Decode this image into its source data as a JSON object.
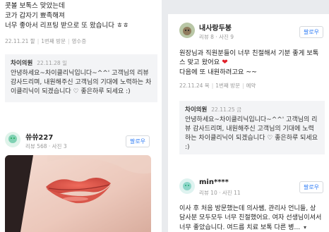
{
  "review_top": {
    "lines": [
      "콧볼 보톡스 맞았는데",
      "코가 갑자기 뾰족해져",
      "너무 좋아서 리프팅 받으로 또 왔습니다 ㅎㅎ"
    ],
    "date": "22.11.21 할",
    "replies": "1번째 방문",
    "receipt": "영수증",
    "reply": {
      "name": "차이의원",
      "date": "22.11.28 일",
      "text": "안녕하세요~차이클리닉입니다~^^' 고객님의 리뷰 감사드리며, 내원해주신 고객님의 기대에 노력하는 차이클리닉이 되겠습니다 ♡ 좋은하루 되세요 :)"
    }
  },
  "review_left_user": {
    "name": "쓔쓔227",
    "stats": "리뷰 568 · 사진 3",
    "follow": "팔로우"
  },
  "review_right_top": {
    "name": "내사랑두봉",
    "stats": "리뷰 8 · 사진 9",
    "follow": "팔로우",
    "line1": "원장님과 직원분들이 너무 친절해서 기분 좋게 보톡스 맞고 왔어요",
    "line2": "다음에 또 내원하려고요 ~~",
    "date": "22.11.24 목",
    "visits": "1번째 방문",
    "booking": "예약",
    "reply": {
      "name": "차이의원",
      "date": "22.11.25 금",
      "text": "안녕하세요~차이클리닉입니다~^^' 고객님의 리뷰 감사드리며, 내원해주신 고객님의 기대에 노력하는 차이클리닉이 되겠습니다 ♡ 좋은하루 되세요 :)"
    }
  },
  "review_right_bottom": {
    "name": "min****",
    "stats": "리뷰 10 · 사진 11",
    "follow": "팔로우",
    "text": "이사 후 처음 방문했는데 의사쌤, 관리사 언니들, 상 담사분 모두모두 너무 친절했어요. 여자 선생님이셔서 너무 좋았습니다. 여드름 치료 보톡 다른 병..."
  },
  "colors": {
    "accent": "#2f7cf6",
    "heart": "#e0202a",
    "reply_bg": "#f3f4f6"
  }
}
